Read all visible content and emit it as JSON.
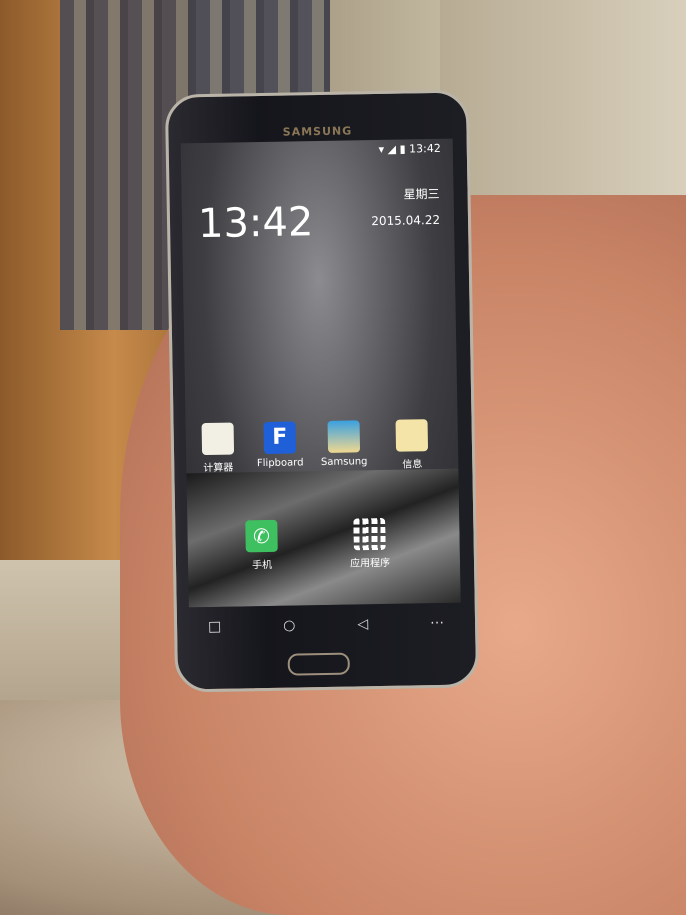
{
  "phone": {
    "brand": "SAMSUNG"
  },
  "status_bar": {
    "time": "13:42",
    "icons": [
      "wifi-icon",
      "signal-icon",
      "battery-icon"
    ]
  },
  "widget": {
    "clock": "13:42",
    "weekday": "星期三",
    "date": "2015.04.22"
  },
  "apps": [
    {
      "label": "计算器",
      "icon": "calculator-icon",
      "color": "#f2efe4"
    },
    {
      "label": "Flipboard",
      "icon": "flipboard-icon",
      "color": "#1f5fd8"
    },
    {
      "label": "Samsung",
      "icon": "samsung-apps-icon",
      "color": "#3aa0e0"
    },
    {
      "label": "信息",
      "icon": "messages-icon",
      "color": "#f4e4a8"
    }
  ],
  "dock": [
    {
      "label": "手机",
      "icon": "phone-icon",
      "color": "#3fc060"
    },
    {
      "label": "应用程序",
      "icon": "apps-grid-icon",
      "color": "#ffffff"
    }
  ],
  "nav": {
    "recent": "□",
    "home": "○",
    "back": "◁",
    "menu": "⋯"
  }
}
